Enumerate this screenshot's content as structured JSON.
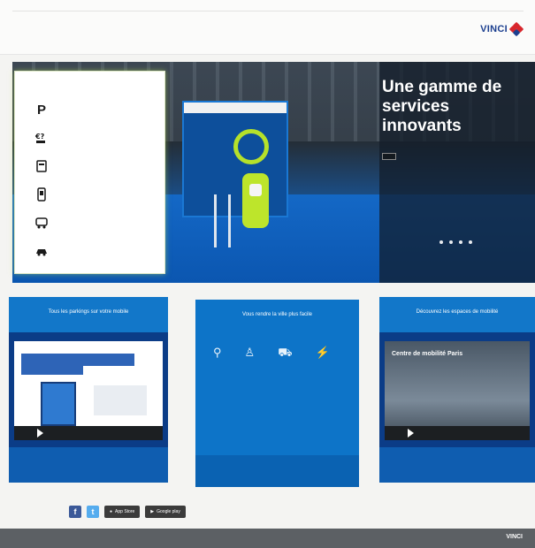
{
  "nav": {
    "items": [
      "",
      "",
      "",
      "",
      "",
      "",
      "",
      ""
    ],
    "logo_text": "VINCI"
  },
  "hero": {
    "title": "Une gamme de services innovants",
    "button_label": "",
    "slides_count": 4
  },
  "search_panel": {
    "title": "",
    "items": [
      {
        "icon": "parking-p-icon",
        "label": "",
        "sub": ""
      },
      {
        "icon": "price-calculator-icon",
        "label": "",
        "sub": ""
      },
      {
        "icon": "subscription-icon",
        "label": "",
        "sub": ""
      },
      {
        "icon": "reservation-phone-icon",
        "label": "",
        "sub": ""
      },
      {
        "icon": "car-rental-icon",
        "label": "",
        "sub": ""
      },
      {
        "icon": "car-purchase-icon",
        "label": "",
        "sub": ""
      }
    ]
  },
  "cards": {
    "left": {
      "header": "Tous les parkings sur votre mobile",
      "footer": ""
    },
    "middle": {
      "title": "Vous rendre la ville plus facile",
      "body": "",
      "footer": ""
    },
    "right": {
      "header": "Découvrez les espaces de mobilité",
      "video_title": "Centre de mobilité Paris",
      "footer": ""
    }
  },
  "social": {
    "label": "",
    "app_store": "App Store",
    "google_play": "Google play"
  },
  "footer": {
    "links": [
      "",
      "",
      ""
    ],
    "logo_text": "VINCI"
  },
  "colors": {
    "brand_blue": "#1c3f8f",
    "card_blue": "#0d74c8",
    "accent_green": "#bde52b",
    "logo_red": "#d8262c"
  }
}
